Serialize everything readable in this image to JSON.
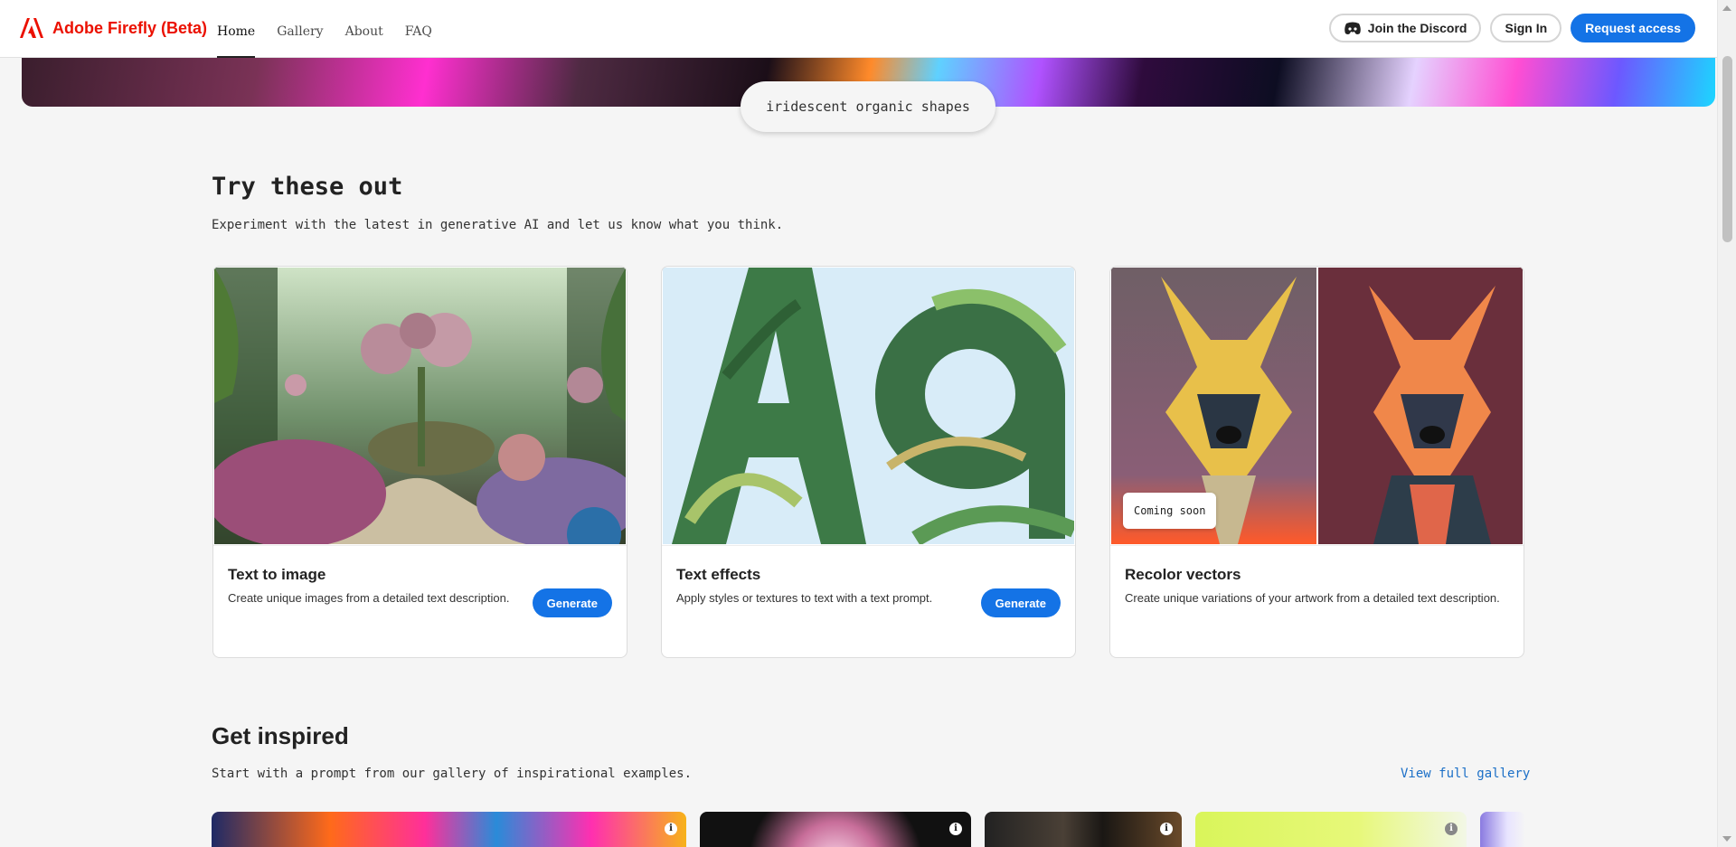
{
  "header": {
    "brand": "Adobe Firefly (Beta)",
    "nav": [
      "Home",
      "Gallery",
      "About",
      "FAQ"
    ],
    "discord_label": "Join the Discord",
    "signin_label": "Sign In",
    "request_label": "Request access"
  },
  "hero": {
    "prompt": "iridescent organic shapes"
  },
  "try_section": {
    "title": "Try these out",
    "subtitle": "Experiment with the latest in generative AI and let us know what you think.",
    "cards": [
      {
        "title": "Text to image",
        "desc": "Create unique images from a detailed text description.",
        "button": "Generate"
      },
      {
        "title": "Text effects",
        "desc": "Apply styles or textures to text with a text prompt.",
        "button": "Generate"
      },
      {
        "title": "Recolor vectors",
        "desc": "Create unique variations of your artwork from a detailed text description.",
        "badge": "Coming soon"
      }
    ]
  },
  "inspired_section": {
    "title": "Get inspired",
    "subtitle": "Start with a prompt from our gallery of inspirational examples.",
    "link": "View full gallery"
  },
  "colors": {
    "accent": "#1473e6",
    "brand_red": "#eb1000"
  }
}
